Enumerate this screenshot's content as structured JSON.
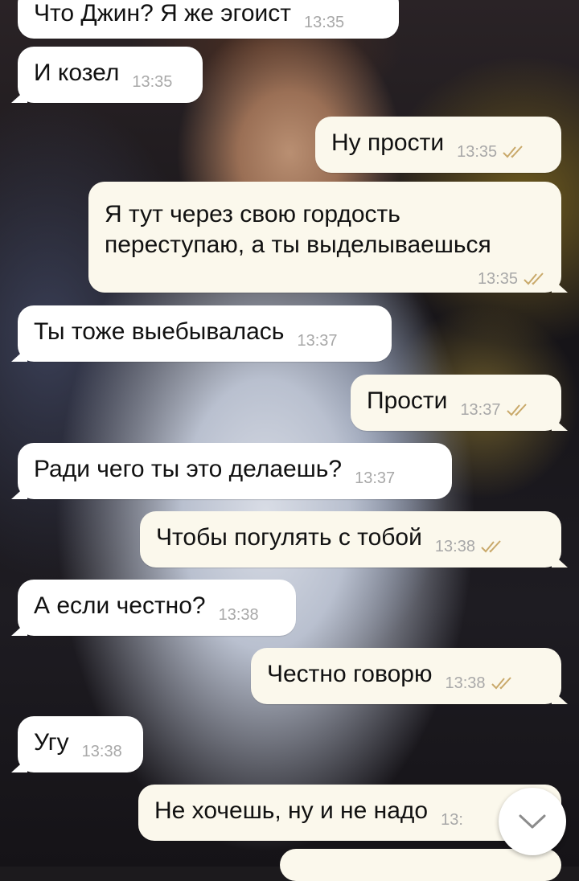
{
  "messages": [
    {
      "text": "Что Джин? Я же эгоист",
      "time": "13:35",
      "direction": "in",
      "read": false
    },
    {
      "text": "И козел",
      "time": "13:35",
      "direction": "in",
      "read": false
    },
    {
      "text": "Ну прости",
      "time": "13:35",
      "direction": "out",
      "read": true
    },
    {
      "text": "Я тут через свою гордость переступаю, а ты выделываешься",
      "time": "13:35",
      "direction": "out",
      "read": true
    },
    {
      "text": "Ты тоже выебывалась",
      "time": "13:37",
      "direction": "in",
      "read": false
    },
    {
      "text": "Прости",
      "time": "13:37",
      "direction": "out",
      "read": true
    },
    {
      "text": "Ради чего ты это делаешь?",
      "time": "13:37",
      "direction": "in",
      "read": false
    },
    {
      "text": "Чтобы погулять с тобой",
      "time": "13:38",
      "direction": "out",
      "read": true
    },
    {
      "text": "А если честно?",
      "time": "13:38",
      "direction": "in",
      "read": false
    },
    {
      "text": "Честно говорю",
      "time": "13:38",
      "direction": "out",
      "read": true
    },
    {
      "text": "Угу",
      "time": "13:38",
      "direction": "in",
      "read": false
    },
    {
      "text": "Не хочешь, ну и не надо",
      "time": "13:",
      "direction": "out",
      "read": true
    },
    {
      "text": "",
      "time": "",
      "direction": "out",
      "read": false
    }
  ],
  "colors": {
    "incoming_bubble": "#ffffff",
    "outgoing_bubble": "#fbf8ec",
    "read_check": "#c9a96a",
    "time_text": "#a8a8a8"
  },
  "icons": {
    "read_receipt": "double-check-icon",
    "scroll_down": "chevron-down-icon"
  }
}
